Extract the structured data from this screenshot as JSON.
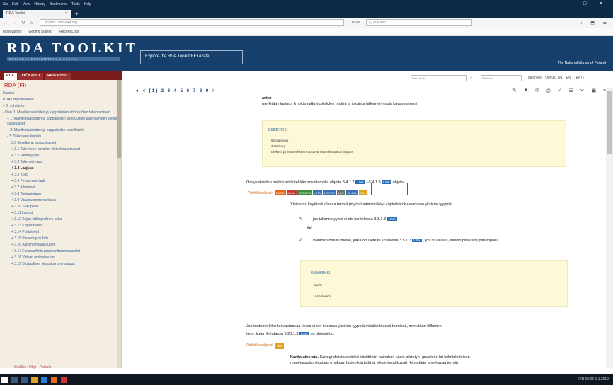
{
  "window": {
    "menu": [
      "Sis",
      "Edit",
      "View",
      "History",
      "Bookmarks",
      "Tools",
      "Help"
    ],
    "controls": "– □ ✕"
  },
  "tabs": [
    {
      "label": "RDA Toolkit",
      "close": "×"
    }
  ],
  "tab_add": "+",
  "nav": {
    "url": "access.rdatoolkit.org",
    "zoom": "100%",
    "find": "Q ei-suomi",
    "actions": "↓ ⬒ ☰"
  },
  "bookmarks": [
    "Most visited",
    "Getting Started",
    "Recent Logs"
  ],
  "header": {
    "logo": "RDA TOOLKIT",
    "subtitle": "RESOURCE DESCRIPTION & ACCESS",
    "beta_button": "Explore the RDA Toolkit BETA site",
    "library": "The National Library of Finland"
  },
  "sidebar_tabs": [
    "RDA",
    "TYÖKALUT",
    "RESURSSIT"
  ],
  "sidebar": {
    "title": "RDA (FI)",
    "items": [
      {
        "t": "Etusivu",
        "bold": false
      },
      {
        "t": "RDA Ohjeistoaiheet",
        "bold": false
      },
      {
        "t": "+ 0: Johdanto",
        "bold": false
      },
      {
        "t": "- Osio 1: Manifestaatioiden ja kappaleiden attribuuttien tallentaminen",
        "bold": false
      },
      {
        "t": "  + 1: Manifestaatioiden ja kappaleiden attribuuttien tallentamisen yleiset suositukset",
        "bold": false
      },
      {
        "t": "  + 2: Manifestaatioiden ja kappaleiden identifiointi",
        "bold": false
      },
      {
        "t": "  - 3: Tallenteen kuvailu",
        "bold": false
      },
      {
        "t": "    3.0  Soveltuvat ja suositukset",
        "bold": false
      },
      {
        "t": "    + 3.1  Tallenteen kuvailun yleiset suositukset",
        "bold": false
      },
      {
        "t": "    + 3.2  Mediatyyppi",
        "bold": false
      },
      {
        "t": "    + 3.3  Tallennetyyppi",
        "bold": false
      },
      {
        "t": "    + 3.4  Laajuus",
        "bold": true
      },
      {
        "t": "    + 3.5  Koko",
        "bold": false
      },
      {
        "t": "    + 3.6  Perusmateriaali",
        "bold": false
      },
      {
        "t": "    + 3.7  Aiheinaat",
        "bold": false
      },
      {
        "t": "    + 3.8  Tuotantotapa",
        "bold": false
      },
      {
        "t": "    + 3.9  Varastuominennoksiva",
        "bold": false
      },
      {
        "t": "    + 3.10  Sukupolvi",
        "bold": false
      },
      {
        "t": "    + 3.11  Layout",
        "bold": false
      },
      {
        "t": "    + 3.12  Kirjan bibliografinen koko",
        "bold": false
      },
      {
        "t": "    + 3.13  Kopiotaivuus",
        "bold": false
      },
      {
        "t": "    + 3.14  Polariteetti",
        "bold": false
      },
      {
        "t": "    + 3.15  Pienennyssuhde",
        "bold": false
      },
      {
        "t": "    + 3.16  Äänen ominaisuudet",
        "bold": false
      },
      {
        "t": "    + 3.17  Elokuvafilmin projisointiominaisuudet",
        "bold": false
      },
      {
        "t": "    + 3.18  Videon ominaisuudet",
        "bold": false
      },
      {
        "t": "    + 3.19  Digitaalisen tiedoston ominaisuus",
        "bold": false
      }
    ]
  },
  "sidebar_footer": "Sisällys  |  Ohje  |  Palaute",
  "tools": {
    "search1": "Etsi sivulta",
    "search2": "Pikahaku",
    "t1": "Tallenteet",
    "t2": "Oletus",
    "t3": "ML",
    "t4": "EN",
    "t5": "TEKTI"
  },
  "pager": "◄ < [1] 2 3 4 5 6 7 8 9 >",
  "toolbar_icons": "✎ ⚑ ✉ ⎙ ✓ ☰ ✂ ▣ ≡",
  "content": {
    "p1": "arten",
    "p2": "merkitään laajuus ilmoittamalla yksiköiden määrä ja jokaista tallennetyyppiä kuvaava termi.",
    "ex1_label": "ESIMERKKI",
    "ex1_items": [
      "56 diakuvaa",
      "1 äänilevy",
      "Elokuva ja lisätarvikkeet koostuvan manifestaation laajuus"
    ],
    "p3a": "Osayksiköiden määrä määritellään soveltamalla ohjeita 3.4.1.7",
    "p3_link1": "LINK",
    "p3b": "–3.4.1.9",
    "p3_link2": "LINK",
    "p3c": "ohjeita.",
    "rules_label": "Politiikkaohjeet:",
    "rules_badges": [
      {
        "t": "MARC",
        "c": "#e6681a"
      },
      {
        "t": "NLNL",
        "c": "#c43b3b"
      },
      {
        "t": "ERDAFIN",
        "c": "#3d8f3d"
      },
      {
        "t": "KITA",
        "c": "#3b6fb5"
      },
      {
        "t": "LC-PCC",
        "c": "#3b6fb5"
      },
      {
        "t": "NLC",
        "c": "#6f6f6f"
      },
      {
        "t": "BL-LBL",
        "c": "#3b6fb5"
      },
      {
        "t": "NBF",
        "c": "#e0a021"
      }
    ],
    "p4": "Yleisessä käytössä olevaa termiä (myös tuotenimi käy) käytetään kuvaamaan yksikön tyyppiä:",
    "a_marker": "a)",
    "a_text": "jos tallennetyyppi ei ole luettelossa 3.3.1.3",
    "a_link": "LINK",
    "tai": "tai",
    "b_marker": "b)",
    "b_text1": "vaihtoehtona termeille, jotka on lueteltu kohdassa 3.3.1.3",
    "b_link": "LINK",
    "b_text2": ", jos kuvaileva yhteisö pitää sitä parempana.",
    "ex2_label": "ESIMERKKI",
    "ex2_items": [
      "äänite",
      "VHS-kasetti"
    ],
    "p5a": "Jos tuotemerkiksi tai vastaavaa tietoa ei ole tiedossa yksikön tyyppiä määriteltäessä termissä, merkitään tällainen",
    "p5b": "tieto, kuten kohdassa 3.20.1.3",
    "p5_link": "LINK",
    "p5c": "on ohjeistettu.",
    "rules2_label": "Politiikkaohjeet:",
    "rules2_badge": {
      "t": "NBF",
      "c": "#e0a021"
    },
    "p6_bold": "Kartta-aineisto.",
    "p6a": "Kartografisista sisältöä käsittävän painatun, käsin piirretyn, graafisen tai kolmiulotteisen",
    "p6b": "manifestaation laajuus (mukaan lukien käytettävä tekstinjakai kuvat), käytetään soveltuvaa termiä"
  },
  "taskbar": {
    "tray": "FIN 09:26 1.1.2019"
  }
}
